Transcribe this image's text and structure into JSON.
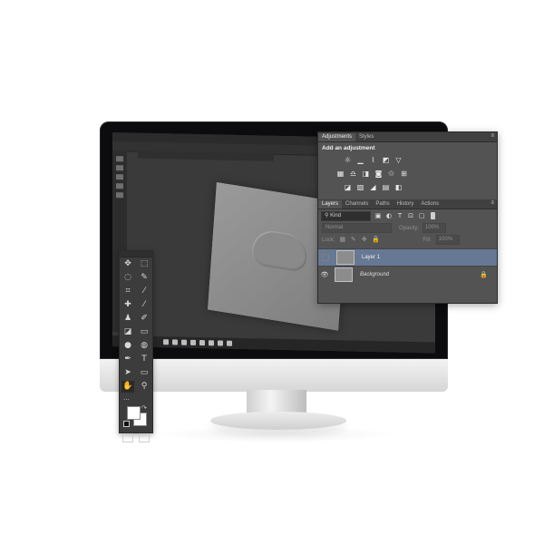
{
  "adjustments_panel": {
    "tabs": [
      {
        "label": "Adjustments",
        "active": true
      },
      {
        "label": "Styles",
        "active": false
      }
    ],
    "title": "Add an adjustment",
    "icon_rows": [
      [
        "brightness-contrast-icon",
        "levels-icon",
        "curves-icon",
        "exposure-icon",
        "vibrance-icon"
      ],
      [
        "hue-saturation-icon",
        "color-balance-icon",
        "black-white-icon",
        "photo-filter-icon",
        "channel-mixer-icon",
        "color-lookup-icon"
      ],
      [
        "invert-icon",
        "posterize-icon",
        "threshold-icon",
        "gradient-map-icon",
        "selective-color-icon"
      ]
    ]
  },
  "layers_panel": {
    "tabs": [
      {
        "label": "Layers",
        "active": true
      },
      {
        "label": "Channels",
        "active": false
      },
      {
        "label": "Paths",
        "active": false
      },
      {
        "label": "History",
        "active": false
      },
      {
        "label": "Actions",
        "active": false
      }
    ],
    "filter_kind": "Kind",
    "blend_mode": "Normal",
    "opacity_label": "Opacity:",
    "opacity_value": "100%",
    "lock_label": "Lock:",
    "fill_label": "Fill:",
    "fill_value": "100%",
    "layers": [
      {
        "name": "Layer 1",
        "selected": true,
        "visible": false
      },
      {
        "name": "Background",
        "selected": false,
        "visible": true,
        "locked": true
      }
    ]
  },
  "tools_panel": {
    "tools": [
      [
        "move-tool-icon",
        "marquee-tool-icon"
      ],
      [
        "lasso-tool-icon",
        "quick-selection-tool-icon"
      ],
      [
        "crop-tool-icon",
        "eyedropper-tool-icon"
      ],
      [
        "healing-brush-tool-icon",
        "brush-tool-icon"
      ],
      [
        "clone-stamp-tool-icon",
        "history-brush-tool-icon"
      ],
      [
        "eraser-tool-icon",
        "gradient-tool-icon"
      ],
      [
        "blur-tool-icon",
        "dodge-tool-icon"
      ],
      [
        "pen-tool-icon",
        "type-tool-icon"
      ],
      [
        "path-selection-tool-icon",
        "rectangle-tool-icon"
      ],
      [
        "hand-tool-icon",
        "zoom-tool-icon"
      ]
    ],
    "type_tool_glyph": "T",
    "more_tools": "...",
    "foreground_color": "#ffffff",
    "background_color": "#ffffff"
  },
  "colors": {
    "panel_bg": "#535353",
    "selected_layer": "#677894",
    "monitor_bezel": "#0c0c0e"
  }
}
